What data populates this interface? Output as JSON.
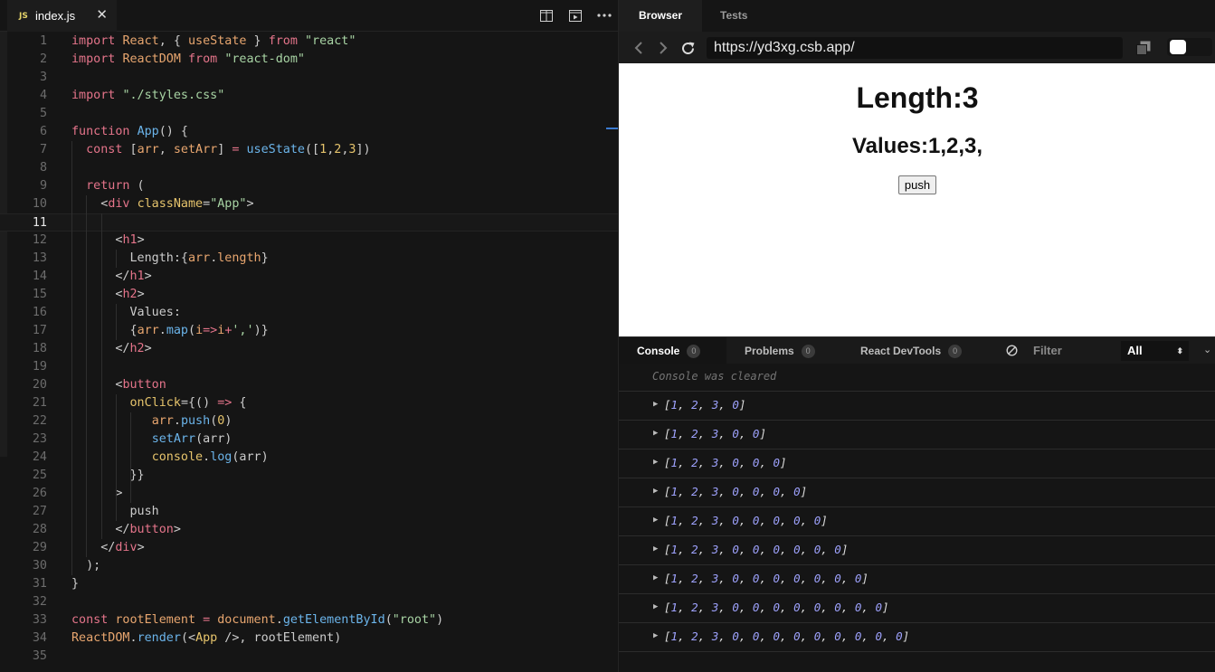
{
  "editor": {
    "tab": {
      "icon_label": "JS",
      "file_name": "index.js",
      "close": "✕"
    },
    "current_line": 11,
    "code_lines": [
      [
        [
          "k",
          "import"
        ],
        [
          "p",
          " "
        ],
        [
          "v",
          "React"
        ],
        [
          "p",
          ", { "
        ],
        [
          "v",
          "useState"
        ],
        [
          "p",
          " } "
        ],
        [
          "k",
          "from"
        ],
        [
          "p",
          " "
        ],
        [
          "s",
          "\"react\""
        ]
      ],
      [
        [
          "k",
          "import"
        ],
        [
          "p",
          " "
        ],
        [
          "v",
          "ReactDOM"
        ],
        [
          "p",
          " "
        ],
        [
          "k",
          "from"
        ],
        [
          "p",
          " "
        ],
        [
          "s",
          "\"react-dom\""
        ]
      ],
      [],
      [
        [
          "k",
          "import"
        ],
        [
          "p",
          " "
        ],
        [
          "s",
          "\"./styles.css\""
        ]
      ],
      [],
      [
        [
          "k",
          "function"
        ],
        [
          "p",
          " "
        ],
        [
          "f",
          "App"
        ],
        [
          "p",
          "() {"
        ]
      ],
      [
        [
          "p",
          "  "
        ],
        [
          "k",
          "const"
        ],
        [
          "p",
          " ["
        ],
        [
          "v",
          "arr"
        ],
        [
          "p",
          ", "
        ],
        [
          "v",
          "setArr"
        ],
        [
          "p",
          "] "
        ],
        [
          "k",
          "="
        ],
        [
          "p",
          " "
        ],
        [
          "f",
          "useState"
        ],
        [
          "p",
          "(["
        ],
        [
          "n",
          "1"
        ],
        [
          "p",
          ","
        ],
        [
          "n",
          "2"
        ],
        [
          "p",
          ","
        ],
        [
          "n",
          "3"
        ],
        [
          "p",
          "])"
        ]
      ],
      [],
      [
        [
          "p",
          "  "
        ],
        [
          "k",
          "return"
        ],
        [
          "p",
          " ("
        ]
      ],
      [
        [
          "p",
          "    <"
        ],
        [
          "t",
          "div"
        ],
        [
          "p",
          " "
        ],
        [
          "a",
          "className"
        ],
        [
          "p",
          "="
        ],
        [
          "s",
          "\"App\""
        ],
        [
          "p",
          ">"
        ]
      ],
      [],
      [
        [
          "p",
          "      <"
        ],
        [
          "t",
          "h1"
        ],
        [
          "p",
          ">"
        ]
      ],
      [
        [
          "p",
          "        Length:{"
        ],
        [
          "v",
          "arr"
        ],
        [
          "p",
          "."
        ],
        [
          "v",
          "length"
        ],
        [
          "p",
          "}"
        ]
      ],
      [
        [
          "p",
          "      </"
        ],
        [
          "t",
          "h1"
        ],
        [
          "p",
          ">"
        ]
      ],
      [
        [
          "p",
          "      <"
        ],
        [
          "t",
          "h2"
        ],
        [
          "p",
          ">"
        ]
      ],
      [
        [
          "p",
          "        Values:"
        ]
      ],
      [
        [
          "p",
          "        {"
        ],
        [
          "v",
          "arr"
        ],
        [
          "p",
          "."
        ],
        [
          "f",
          "map"
        ],
        [
          "p",
          "("
        ],
        [
          "v",
          "i"
        ],
        [
          "k",
          "=>"
        ],
        [
          "v",
          "i"
        ],
        [
          "k",
          "+"
        ],
        [
          "s",
          "','"
        ],
        [
          "p",
          ")}"
        ]
      ],
      [
        [
          "p",
          "      </"
        ],
        [
          "t",
          "h2"
        ],
        [
          "p",
          ">"
        ]
      ],
      [],
      [
        [
          "p",
          "      <"
        ],
        [
          "t",
          "button"
        ]
      ],
      [
        [
          "p",
          "        "
        ],
        [
          "a",
          "onClick"
        ],
        [
          "p",
          "={() "
        ],
        [
          "k",
          "=>"
        ],
        [
          "p",
          " {"
        ]
      ],
      [
        [
          "p",
          "           "
        ],
        [
          "v",
          "arr"
        ],
        [
          "p",
          "."
        ],
        [
          "f",
          "push"
        ],
        [
          "p",
          "("
        ],
        [
          "n",
          "0"
        ],
        [
          "p",
          ")"
        ]
      ],
      [
        [
          "p",
          "           "
        ],
        [
          "f",
          "setArr"
        ],
        [
          "p",
          "(arr)"
        ]
      ],
      [
        [
          "p",
          "           "
        ],
        [
          "a",
          "console"
        ],
        [
          "p",
          "."
        ],
        [
          "f",
          "log"
        ],
        [
          "p",
          "(arr)"
        ]
      ],
      [
        [
          "p",
          "        }}"
        ]
      ],
      [
        [
          "p",
          "      >"
        ]
      ],
      [
        [
          "p",
          "        push"
        ]
      ],
      [
        [
          "p",
          "      </"
        ],
        [
          "t",
          "button"
        ],
        [
          "p",
          ">"
        ]
      ],
      [
        [
          "p",
          "    </"
        ],
        [
          "t",
          "div"
        ],
        [
          "p",
          ">"
        ]
      ],
      [
        [
          "p",
          "  );"
        ]
      ],
      [
        [
          "p",
          "}"
        ]
      ],
      [],
      [
        [
          "k",
          "const"
        ],
        [
          "p",
          " "
        ],
        [
          "v",
          "rootElement"
        ],
        [
          "p",
          " "
        ],
        [
          "k",
          "="
        ],
        [
          "p",
          " "
        ],
        [
          "v",
          "document"
        ],
        [
          "p",
          "."
        ],
        [
          "f",
          "getElementById"
        ],
        [
          "p",
          "("
        ],
        [
          "s",
          "\"root\""
        ],
        [
          "p",
          ")"
        ]
      ],
      [
        [
          "v",
          "ReactDOM"
        ],
        [
          "p",
          "."
        ],
        [
          "f",
          "render"
        ],
        [
          "p",
          "(<"
        ],
        [
          "a",
          "App"
        ],
        [
          "p",
          " />, rootElement)"
        ]
      ],
      []
    ],
    "icons": [
      "split-editor-icon",
      "preview-icon",
      "more-icon"
    ]
  },
  "panel": {
    "tabs": {
      "browser": "Browser",
      "tests": "Tests"
    },
    "url": "https://yd3xg.csb.app/",
    "preview": {
      "h1": "Length:3",
      "h2": "Values:1,2,3,",
      "button": "push"
    }
  },
  "devtools": {
    "tabs": [
      {
        "label": "Console",
        "count": "0"
      },
      {
        "label": "Problems",
        "count": "0"
      },
      {
        "label": "React DevTools",
        "count": "0"
      }
    ],
    "filter_label": "Filter",
    "level": "All",
    "cleared_message": "Console was cleared",
    "logs": [
      [
        1,
        2,
        3,
        0
      ],
      [
        1,
        2,
        3,
        0,
        0
      ],
      [
        1,
        2,
        3,
        0,
        0,
        0
      ],
      [
        1,
        2,
        3,
        0,
        0,
        0,
        0
      ],
      [
        1,
        2,
        3,
        0,
        0,
        0,
        0,
        0
      ],
      [
        1,
        2,
        3,
        0,
        0,
        0,
        0,
        0,
        0
      ],
      [
        1,
        2,
        3,
        0,
        0,
        0,
        0,
        0,
        0,
        0
      ],
      [
        1,
        2,
        3,
        0,
        0,
        0,
        0,
        0,
        0,
        0,
        0
      ],
      [
        1,
        2,
        3,
        0,
        0,
        0,
        0,
        0,
        0,
        0,
        0,
        0
      ]
    ]
  }
}
